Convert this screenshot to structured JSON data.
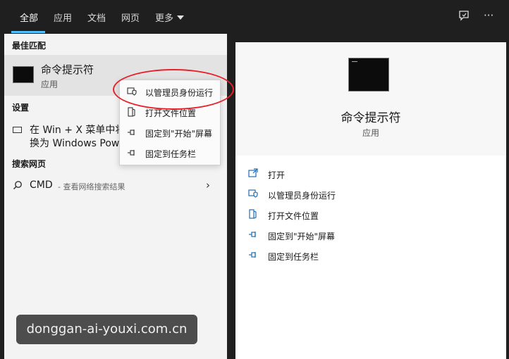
{
  "header": {
    "tabs": [
      {
        "label": "全部"
      },
      {
        "label": "应用"
      },
      {
        "label": "文档"
      },
      {
        "label": "网页"
      },
      {
        "label": "更多"
      }
    ],
    "feedback_icon": "feedback-icon",
    "more_options": "···"
  },
  "left": {
    "best_match": {
      "title": "最佳匹配",
      "name": "命令提示符",
      "subtitle": "应用"
    },
    "settings": {
      "title": "设置",
      "line1": "在 Win + X 菜单中将",
      "line2": "换为 Windows Pow"
    },
    "web": {
      "title": "搜索网页",
      "term": "CMD",
      "hint": "- 查看网络搜索结果"
    }
  },
  "context_menu": {
    "items": [
      {
        "label": "以管理员身份运行",
        "icon": "shield-icon"
      },
      {
        "label": "打开文件位置",
        "icon": "folder-icon"
      },
      {
        "label": "固定到\"开始\"屏幕",
        "icon": "pin-icon"
      },
      {
        "label": "固定到任务栏",
        "icon": "pin-icon"
      }
    ]
  },
  "right": {
    "name": "命令提示符",
    "subtitle": "应用",
    "actions": [
      {
        "label": "打开",
        "icon": "open-icon"
      },
      {
        "label": "以管理员身份运行",
        "icon": "shield-icon"
      },
      {
        "label": "打开文件位置",
        "icon": "folder-icon"
      },
      {
        "label": "固定到\"开始\"屏幕",
        "icon": "pin-icon"
      },
      {
        "label": "固定到任务栏",
        "icon": "pin-icon"
      }
    ]
  },
  "watermark": "donggan-ai-youxi.com.cn",
  "colors": {
    "accent": "#4cc2ff",
    "annotation": "#e8202a",
    "action_icon": "#1f6fb5"
  }
}
